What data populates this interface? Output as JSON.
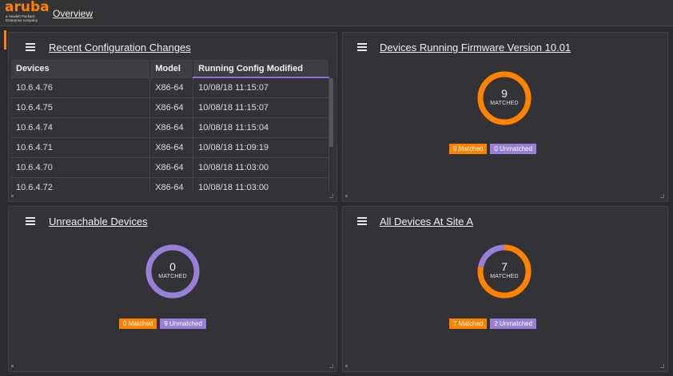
{
  "brand": {
    "logo_text": "aruba",
    "logo_subtext": "a Hewlett Packard Enterprise company"
  },
  "nav": {
    "overview_label": "Overview"
  },
  "colors": {
    "accent": "#ff8300",
    "matched": "#ff8300",
    "unmatched": "#9a7fd8"
  },
  "panels": {
    "config_changes": {
      "title": "Recent Configuration Changes",
      "columns": [
        "Devices",
        "Model",
        "Running Config Modified"
      ],
      "rows": [
        [
          "10.6.4.76",
          "X86-64",
          "10/08/18 11:15:07"
        ],
        [
          "10.6.4.75",
          "X86-64",
          "10/08/18 11:15:07"
        ],
        [
          "10.6.4.74",
          "X86-64",
          "10/08/18 11:15:04"
        ],
        [
          "10.6.4.71",
          "X86-64",
          "10/08/18 11:09:19"
        ],
        [
          "10.6.4.70",
          "X86-64",
          "10/08/18 11:03:00"
        ],
        [
          "10.6.4.72",
          "X86-64",
          "10/08/18 11:03:00"
        ]
      ]
    },
    "firmware": {
      "title": "Devices Running Firmware Version 10.01",
      "matched_count": "9",
      "matched_caption": "MATCHED",
      "matched": 9,
      "unmatched": 0,
      "matched_badge": "9 Matched",
      "unmatched_badge": "0 Unmatched"
    },
    "unreachable": {
      "title": "Unreachable Devices",
      "matched_count": "0",
      "matched_caption": "MATCHED",
      "matched": 0,
      "unmatched": 9,
      "matched_badge": "0 Matched",
      "unmatched_badge": "9 Unmatched"
    },
    "site_a": {
      "title": "All Devices At Site A",
      "matched_count": "7",
      "matched_caption": "MATCHED",
      "matched": 7,
      "unmatched": 2,
      "matched_badge": "7 Matched",
      "unmatched_badge": "2 Unmatched"
    }
  }
}
